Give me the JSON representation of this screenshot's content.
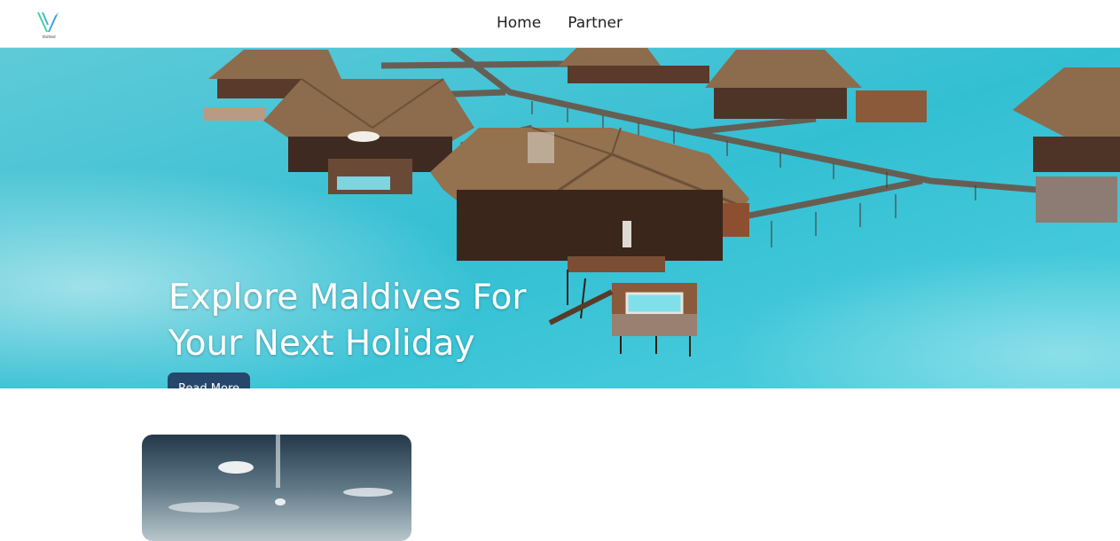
{
  "header": {
    "logo_caption": "Visitted",
    "nav": [
      {
        "label": "Home"
      },
      {
        "label": "Partner"
      }
    ]
  },
  "hero": {
    "title": "Explore Maldives For Your Next Holiday",
    "button_label": "Read More",
    "slide_count": 3,
    "active_slide": 1
  },
  "colors": {
    "button": "#24476b",
    "water": "#3cc3d8",
    "hut_roof": "#8d6b4d"
  }
}
